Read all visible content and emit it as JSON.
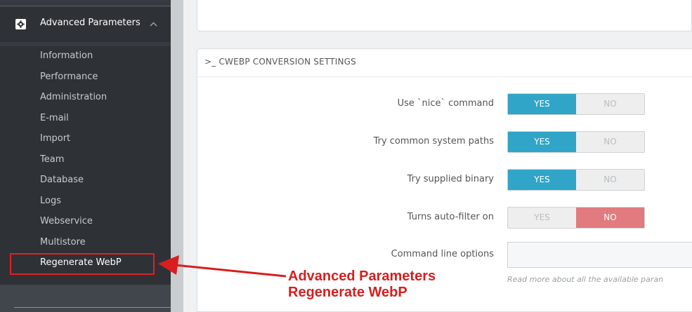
{
  "sidebar": {
    "section_title": "Advanced Parameters",
    "items": [
      {
        "label": "Information"
      },
      {
        "label": "Performance"
      },
      {
        "label": "Administration"
      },
      {
        "label": "E-mail"
      },
      {
        "label": "Import"
      },
      {
        "label": "Team"
      },
      {
        "label": "Database"
      },
      {
        "label": "Logs"
      },
      {
        "label": "Webservice"
      },
      {
        "label": "Multistore"
      },
      {
        "label": "Regenerate WebP"
      }
    ],
    "icons": {
      "section": "gear-icon",
      "collapse": "chevron-up-icon"
    }
  },
  "settings_panel": {
    "title": ">_ CWEBP CONVERSION SETTINGS",
    "fields": [
      {
        "label": "Use `nice` command",
        "yes": "YES",
        "no": "NO",
        "value": "yes"
      },
      {
        "label": "Try common system paths",
        "yes": "YES",
        "no": "NO",
        "value": "yes"
      },
      {
        "label": "Try supplied binary",
        "yes": "YES",
        "no": "NO",
        "value": "yes"
      },
      {
        "label": "Turns auto-filter on",
        "yes": "YES",
        "no": "NO",
        "value": "no"
      }
    ],
    "command_line": {
      "label": "Command line options",
      "value": "",
      "help": "Read more about all the available paran"
    }
  },
  "annotation": {
    "line1": "Advanced Parameters",
    "line2": "Regenerate WebP"
  },
  "colors": {
    "sidebar_bg": "#363a41",
    "yes_active": "#30a5c8",
    "no_active": "#e27b7f",
    "annotation_red": "#d81e1e"
  }
}
